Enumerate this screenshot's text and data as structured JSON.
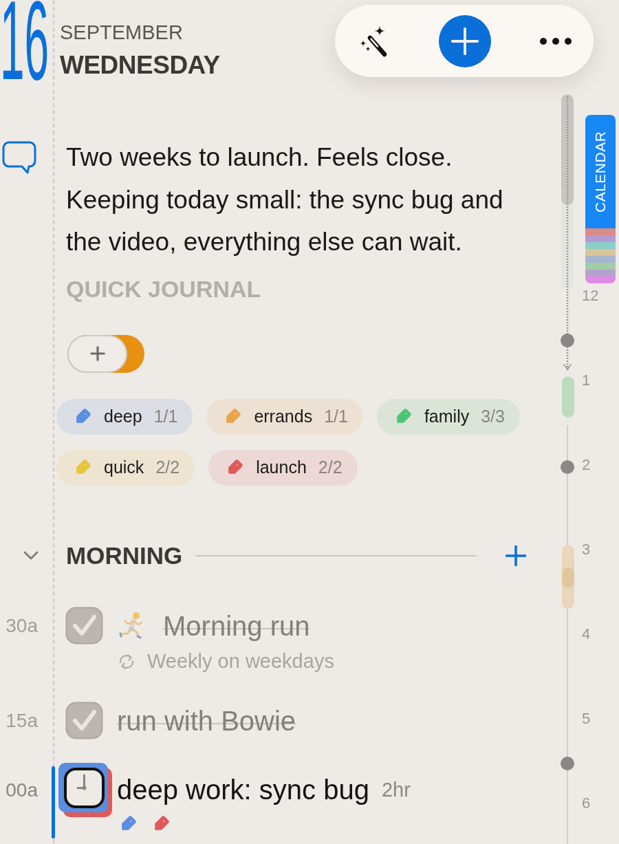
{
  "date": {
    "day": "16",
    "month": "SEPTEMBER",
    "weekday": "WEDNESDAY"
  },
  "toolbar": {
    "buttons": [
      {
        "kind": "magic"
      },
      {
        "kind": "add"
      },
      {
        "kind": "more"
      }
    ]
  },
  "journal": {
    "text": "Two weeks to launch. Feels close. Keeping today small: the sync bug and the video, everything else can wait.",
    "label": "QUICK JOURNAL"
  },
  "tags": [
    {
      "label": "deep",
      "count": "1/1",
      "color": "#5b8de0"
    },
    {
      "label": "errands",
      "count": "1/1",
      "color": "#e8a54a"
    },
    {
      "label": "family",
      "count": "3/3",
      "color": "#4cc577"
    },
    {
      "label": "quick",
      "count": "2/2",
      "color": "#e6c73c"
    },
    {
      "label": "launch",
      "count": "2/2",
      "color": "#e05a5a"
    }
  ],
  "sections": [
    {
      "title": "MORNING",
      "expanded": true,
      "tasks": [
        {
          "kind": "checkbox",
          "time": "30a",
          "title": "Morning run",
          "done": true,
          "current": false,
          "leading_icon": true,
          "repeat": "Weekly on weekdays"
        },
        {
          "kind": "checkbox",
          "time": "15a",
          "title": "run with Bowie",
          "done": true,
          "current": false,
          "leading_icon": false
        },
        {
          "kind": "timed",
          "time": "00a",
          "title": "deep work: sync bug",
          "done": false,
          "current": true,
          "leading_icon": false,
          "duration": "2hr",
          "tags": [
            {
              "color": "#5b8de0"
            },
            {
              "color": "#e05a5a"
            }
          ]
        }
      ]
    }
  ],
  "timeline": {
    "hours": [
      {
        "label": "12"
      },
      {
        "label": "1"
      },
      {
        "label": "2"
      },
      {
        "label": "3"
      },
      {
        "label": "4"
      },
      {
        "label": "5"
      },
      {
        "label": "6"
      }
    ],
    "blocks": [
      {
        "color": "#bcdcc0"
      },
      {
        "color": "#e8d7b9"
      }
    ]
  },
  "calendar_tab": {
    "label": "CALENDAR",
    "stacked_tabs": [
      {
        "color": "#dc8a86"
      },
      {
        "color": "#b59bd3"
      },
      {
        "color": "#8ccfc8"
      },
      {
        "color": "#dbc39c"
      },
      {
        "color": "#a7b5cf"
      },
      {
        "color": "#a0cda8"
      },
      {
        "color": "#b6a2cf"
      },
      {
        "color": "#e08ae3"
      }
    ]
  }
}
